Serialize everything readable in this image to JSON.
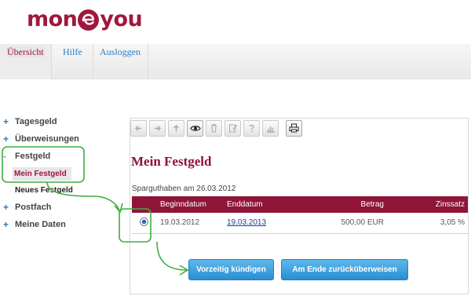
{
  "brand": {
    "logo_left": "mon",
    "logo_right": "you"
  },
  "nav": {
    "tabs": [
      {
        "label": "Übersicht",
        "active": true
      },
      {
        "label": "Hilfe"
      },
      {
        "label": "Ausloggen"
      }
    ]
  },
  "sidebar": {
    "items": [
      {
        "label": "Tagesgeld",
        "expander": "+"
      },
      {
        "label": "Überweisungen",
        "expander": "+"
      },
      {
        "label": "Festgeld",
        "expander": "-"
      },
      {
        "label": "Postfach",
        "expander": "+"
      },
      {
        "label": "Meine Daten",
        "expander": "+"
      }
    ],
    "subitems": [
      {
        "label": "Mein Festgeld",
        "active": true
      },
      {
        "label": "Neues Festgeld"
      }
    ]
  },
  "toolbar": {
    "icons": [
      "arrow-left-icon",
      "arrow-right-icon",
      "arrow-up-icon",
      "eye-icon",
      "trash-icon",
      "edit-icon",
      "help-icon",
      "chart-icon",
      "print-icon"
    ]
  },
  "main": {
    "title": "Mein Festgeld",
    "balance_date": "Sparguthaben am 26.03.2012",
    "table": {
      "headers": [
        "",
        "Beginndatum",
        "Enddatum",
        "Betrag",
        "Zinssatz"
      ],
      "rows": [
        {
          "begin": "19.03.2012",
          "end": "19.03.2013",
          "amount": "500,00 EUR",
          "rate": "3,05 %"
        }
      ]
    },
    "buttons": {
      "early_cancel": "Vorzeitig kündigen",
      "transfer_back": "Am Ende zurücküberweisen"
    }
  },
  "colors": {
    "brand": "#a0183e",
    "header_row": "#8e1538",
    "link": "#2b7bbf",
    "button": "#2a8ed4",
    "annotation": "#3fae3f"
  }
}
